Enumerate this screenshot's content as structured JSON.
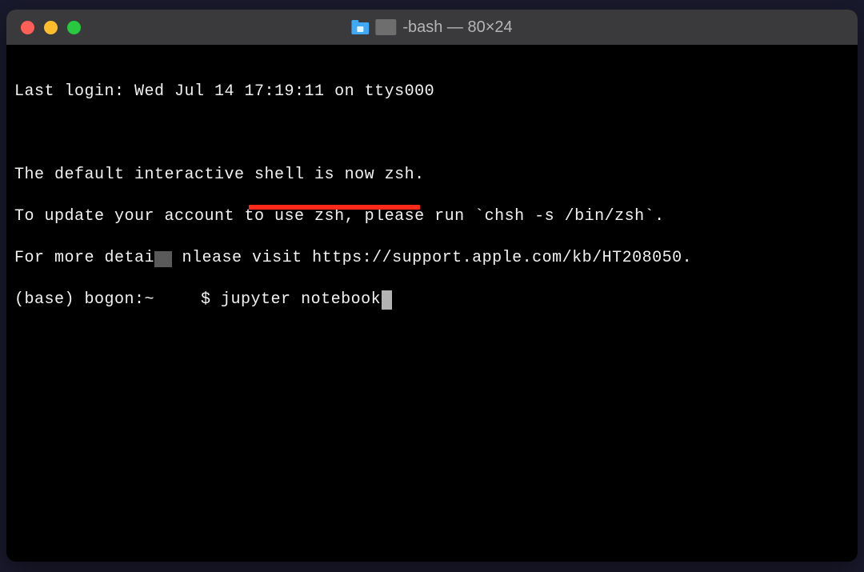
{
  "window": {
    "title_suffix": "-bash — 80×24"
  },
  "terminal": {
    "line1": "Last login: Wed Jul 14 17:19:11 on ttys000",
    "line2": "",
    "line3": "The default interactive shell is now zsh.",
    "line4": "To update your account to use zsh, please run `chsh -s /bin/zsh`.",
    "line5_a": "For more detai",
    "line5_b": "nlease visit https://support.apple.com/kb/HT208050.",
    "prompt_pre": "(base) bogon:~",
    "prompt_dollar": "$ ",
    "command": "jupyter notebook"
  }
}
